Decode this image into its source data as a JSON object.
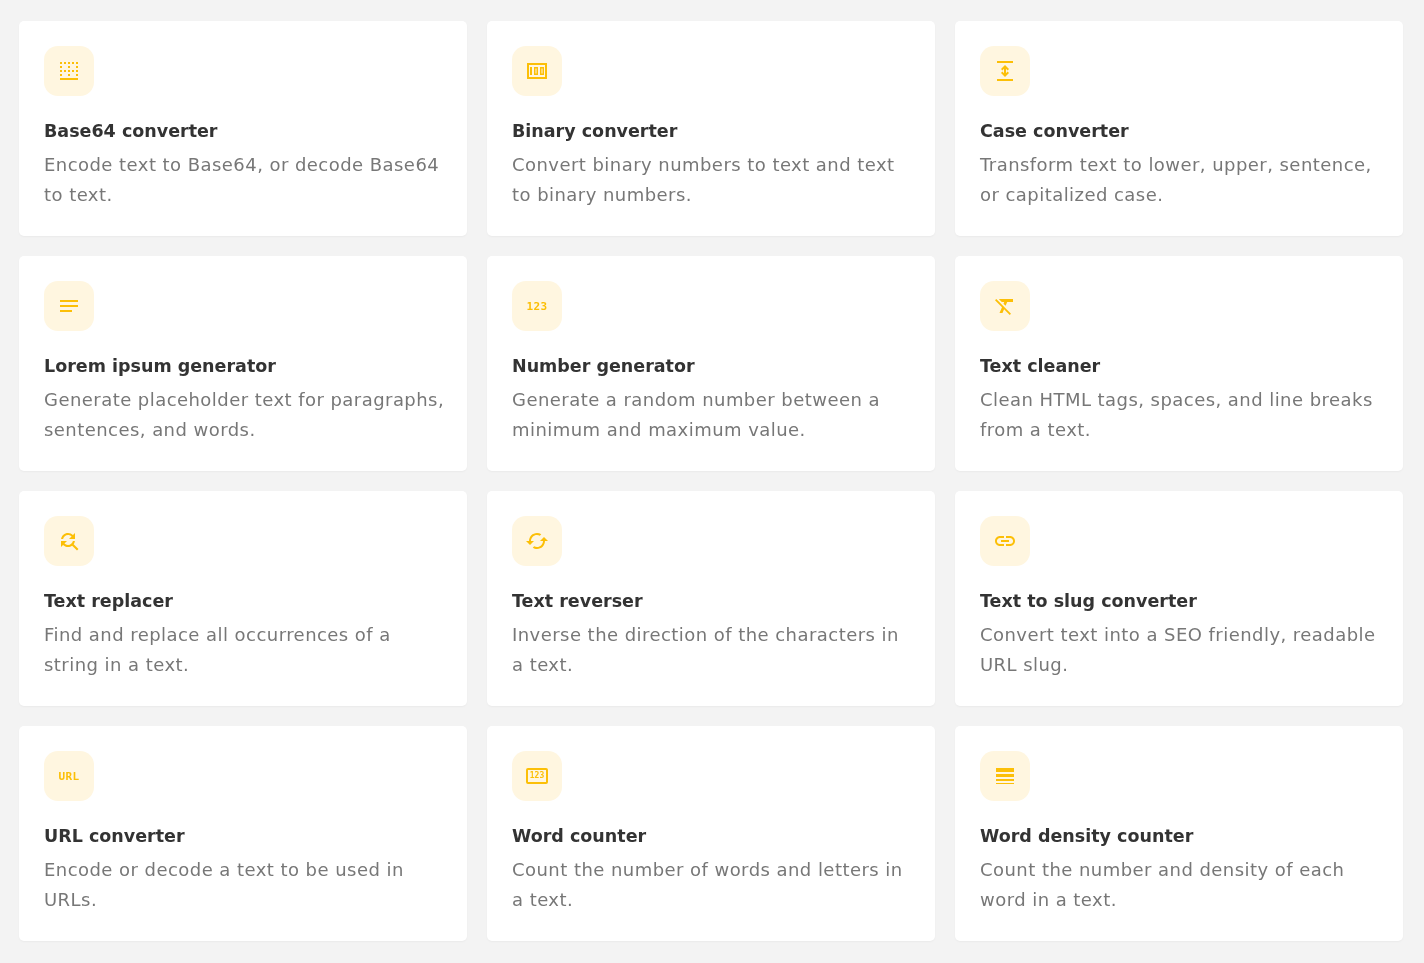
{
  "tools": [
    {
      "title": "Base64 converter",
      "description": "Encode text to Base64, or decode Base64 to text.",
      "icon": {
        "kind": "dotted-grid"
      }
    },
    {
      "title": "Binary converter",
      "description": "Convert binary numbers to text and text to binary numbers.",
      "icon": {
        "kind": "bill"
      }
    },
    {
      "title": "Case converter",
      "description": "Transform text to lower, upper, sentence, or capitalized case.",
      "icon": {
        "kind": "vertical-arrows"
      }
    },
    {
      "title": "Lorem ipsum generator",
      "description": "Generate placeholder text for paragraphs, sentences, and words.",
      "icon": {
        "kind": "text-lines"
      }
    },
    {
      "title": "Number generator",
      "description": "Generate a random number between a minimum and maximum value.",
      "icon": {
        "kind": "glyph",
        "label": "123"
      }
    },
    {
      "title": "Text cleaner",
      "description": "Clean HTML tags, spaces, and line breaks from a text.",
      "icon": {
        "kind": "clear-format"
      }
    },
    {
      "title": "Text replacer",
      "description": "Find and replace all occurrences of a string in a text.",
      "icon": {
        "kind": "find-replace"
      }
    },
    {
      "title": "Text reverser",
      "description": "Inverse the direction of the characters in a text.",
      "icon": {
        "kind": "refresh"
      }
    },
    {
      "title": "Text to slug converter",
      "description": "Convert text into a SEO friendly, readable URL slug.",
      "icon": {
        "kind": "link"
      }
    },
    {
      "title": "URL converter",
      "description": "Encode or decode a text to be used in URLs.",
      "icon": {
        "kind": "glyph",
        "label": "URL"
      }
    },
    {
      "title": "Word counter",
      "description": "Count the number of words and letters in a text.",
      "icon": {
        "kind": "framed-glyph",
        "label": "123"
      }
    },
    {
      "title": "Word density counter",
      "description": "Count the number and density of each word in a text.",
      "icon": {
        "kind": "line-weight"
      }
    }
  ]
}
